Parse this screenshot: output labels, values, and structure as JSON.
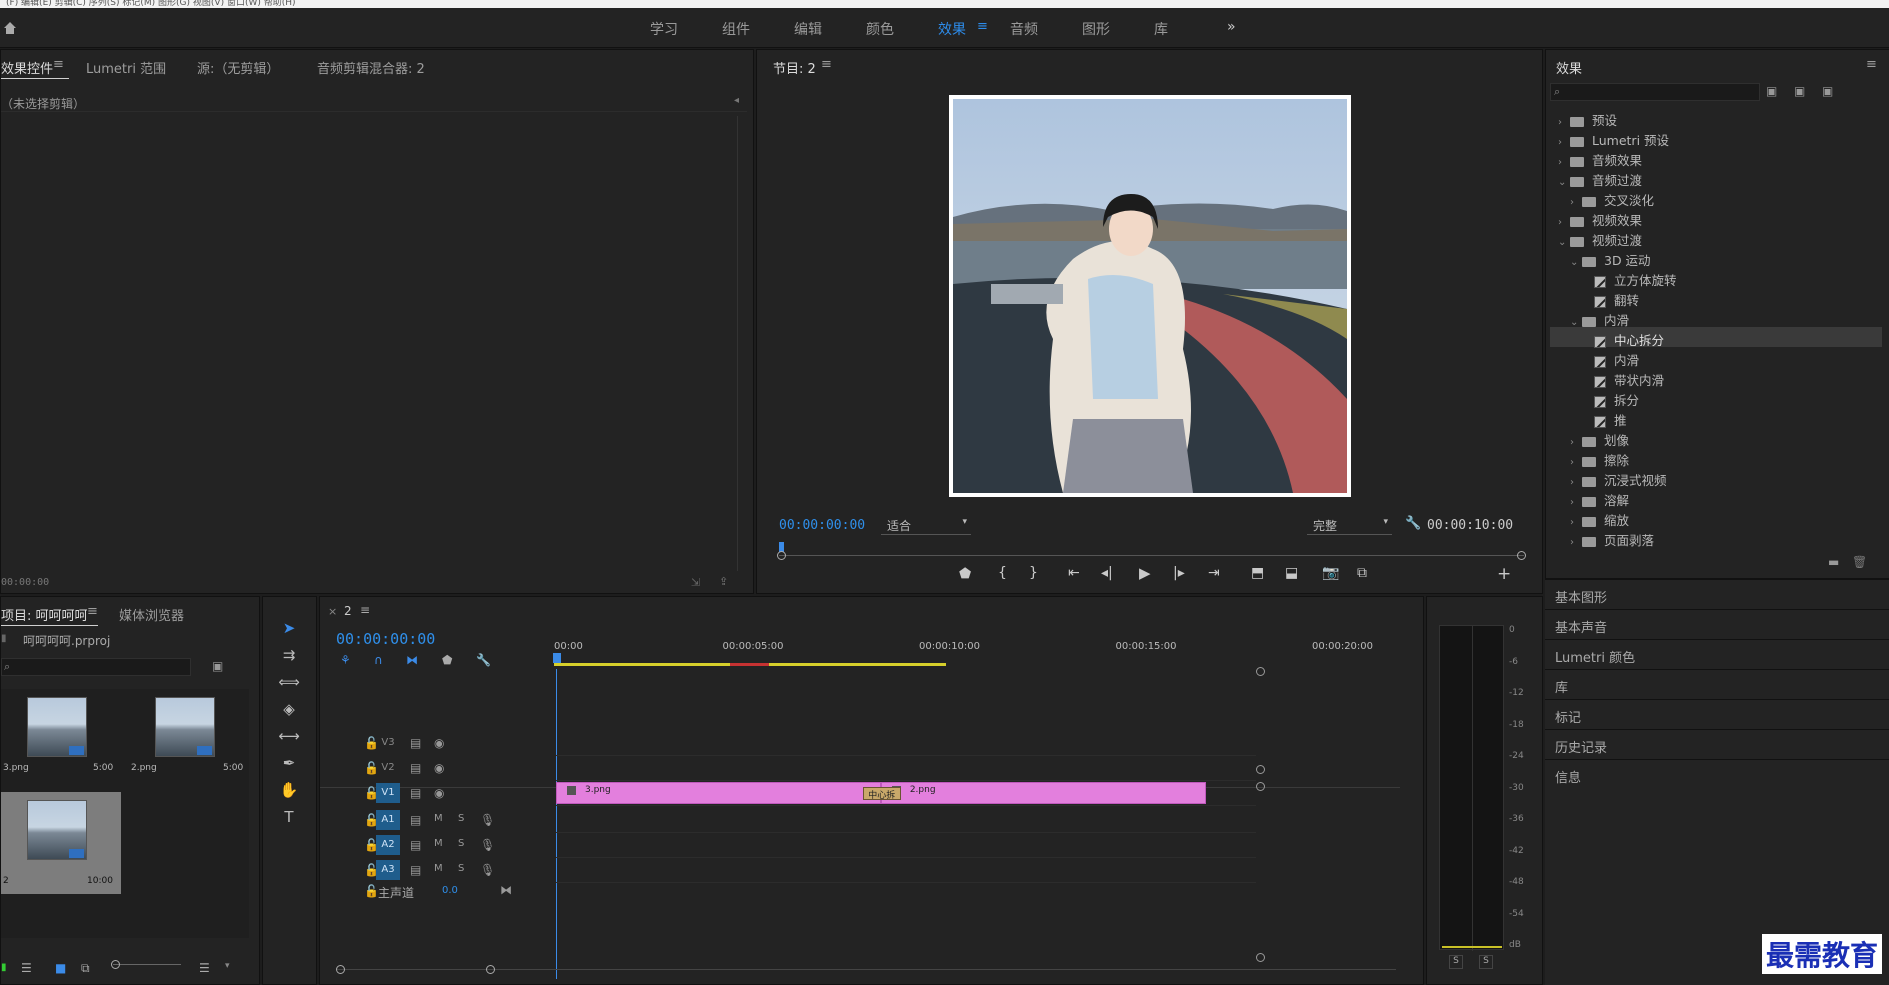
{
  "menu_bar": {
    "items": [
      "(F)",
      "编辑(E)",
      "剪辑(C)",
      "序列(S)",
      "标记(M)",
      "图形(G)",
      "视图(V)",
      "窗口(W)",
      "帮助(H)"
    ]
  },
  "workspace_tabs": [
    "学习",
    "组件",
    "编辑",
    "颜色",
    "效果",
    "音频",
    "图形",
    "库"
  ],
  "workspace_active": "效果",
  "workspace_more": "»",
  "effect_controls": {
    "tabs": [
      "效果控件",
      "Lumetri 范围",
      "源:（无剪辑）",
      "音频剪辑混合器: 2"
    ],
    "no_clip": "（未选择剪辑）",
    "timecode": "00:00:00"
  },
  "program_monitor": {
    "title": "节目: 2",
    "timecode": "00:00:00:00",
    "fit": "适合",
    "quality": "完整",
    "duration": "00:00:10:00"
  },
  "effects_panel": {
    "title": "效果",
    "tree": [
      {
        "label": "预设",
        "depth": 0,
        "type": "folder-star",
        "expanded": false
      },
      {
        "label": "Lumetri 预设",
        "depth": 0,
        "type": "folder-star",
        "expanded": false
      },
      {
        "label": "音频效果",
        "depth": 0,
        "type": "folder",
        "expanded": false
      },
      {
        "label": "音频过渡",
        "depth": 0,
        "type": "folder",
        "expanded": true
      },
      {
        "label": "交叉淡化",
        "depth": 1,
        "type": "folder",
        "expanded": false
      },
      {
        "label": "视频效果",
        "depth": 0,
        "type": "folder",
        "expanded": false
      },
      {
        "label": "视频过渡",
        "depth": 0,
        "type": "folder",
        "expanded": true
      },
      {
        "label": "3D 运动",
        "depth": 1,
        "type": "folder",
        "expanded": true
      },
      {
        "label": "立方体旋转",
        "depth": 2,
        "type": "effect"
      },
      {
        "label": "翻转",
        "depth": 2,
        "type": "effect"
      },
      {
        "label": "内滑",
        "depth": 1,
        "type": "folder",
        "expanded": true
      },
      {
        "label": "中心拆分",
        "depth": 2,
        "type": "effect",
        "selected": true
      },
      {
        "label": "内滑",
        "depth": 2,
        "type": "effect"
      },
      {
        "label": "带状内滑",
        "depth": 2,
        "type": "effect"
      },
      {
        "label": "拆分",
        "depth": 2,
        "type": "effect"
      },
      {
        "label": "推",
        "depth": 2,
        "type": "effect"
      },
      {
        "label": "划像",
        "depth": 1,
        "type": "folder",
        "expanded": false
      },
      {
        "label": "擦除",
        "depth": 1,
        "type": "folder",
        "expanded": false
      },
      {
        "label": "沉浸式视频",
        "depth": 1,
        "type": "folder",
        "expanded": false
      },
      {
        "label": "溶解",
        "depth": 1,
        "type": "folder",
        "expanded": false
      },
      {
        "label": "缩放",
        "depth": 1,
        "type": "folder",
        "expanded": false
      },
      {
        "label": "页面剥落",
        "depth": 1,
        "type": "folder",
        "expanded": false
      }
    ]
  },
  "side_sections": [
    "基本图形",
    "基本声音",
    "Lumetri 颜色",
    "库",
    "标记",
    "历史记录",
    "信息"
  ],
  "project_panel": {
    "tabs": [
      "项目: 呵呵呵呵",
      "媒体浏览器"
    ],
    "file": "呵呵呵呵.prproj",
    "items": [
      {
        "name": "3.png",
        "duration": "5:00"
      },
      {
        "name": "2.png",
        "duration": "5:00"
      },
      {
        "name": "2",
        "duration": "10:00"
      }
    ]
  },
  "timeline": {
    "sequence": "2",
    "timecode": "00:00:00:00",
    "ruler": [
      "00:00",
      "00:00:05:00",
      "00:00:10:00",
      "00:00:15:00",
      "00:00:20:00"
    ],
    "video_tracks": [
      "V3",
      "V2",
      "V1"
    ],
    "audio_tracks": [
      "A1",
      "A2",
      "A3"
    ],
    "master": {
      "label": "主声道",
      "value": "0.0"
    },
    "clips": [
      {
        "name": "3.png",
        "start": 0,
        "end": 5
      },
      {
        "name": "2.png",
        "start": 5,
        "end": 10
      }
    ],
    "transition": {
      "name": "中心拆",
      "at": 5
    },
    "track_buttons": {
      "m": "M",
      "s": "S"
    }
  },
  "audio_meter": {
    "ticks": [
      "0",
      "-6",
      "-12",
      "-18",
      "-24",
      "-30",
      "-36",
      "-42",
      "-48",
      "-54",
      "dB"
    ],
    "solo": [
      "S",
      "S"
    ]
  },
  "watermark": "最需教育",
  "colors": {
    "accent": "#2d8ceb",
    "clip": "#e37fdd",
    "track_highlight": "#1f5d8c",
    "playhead": "#3b8be8"
  }
}
